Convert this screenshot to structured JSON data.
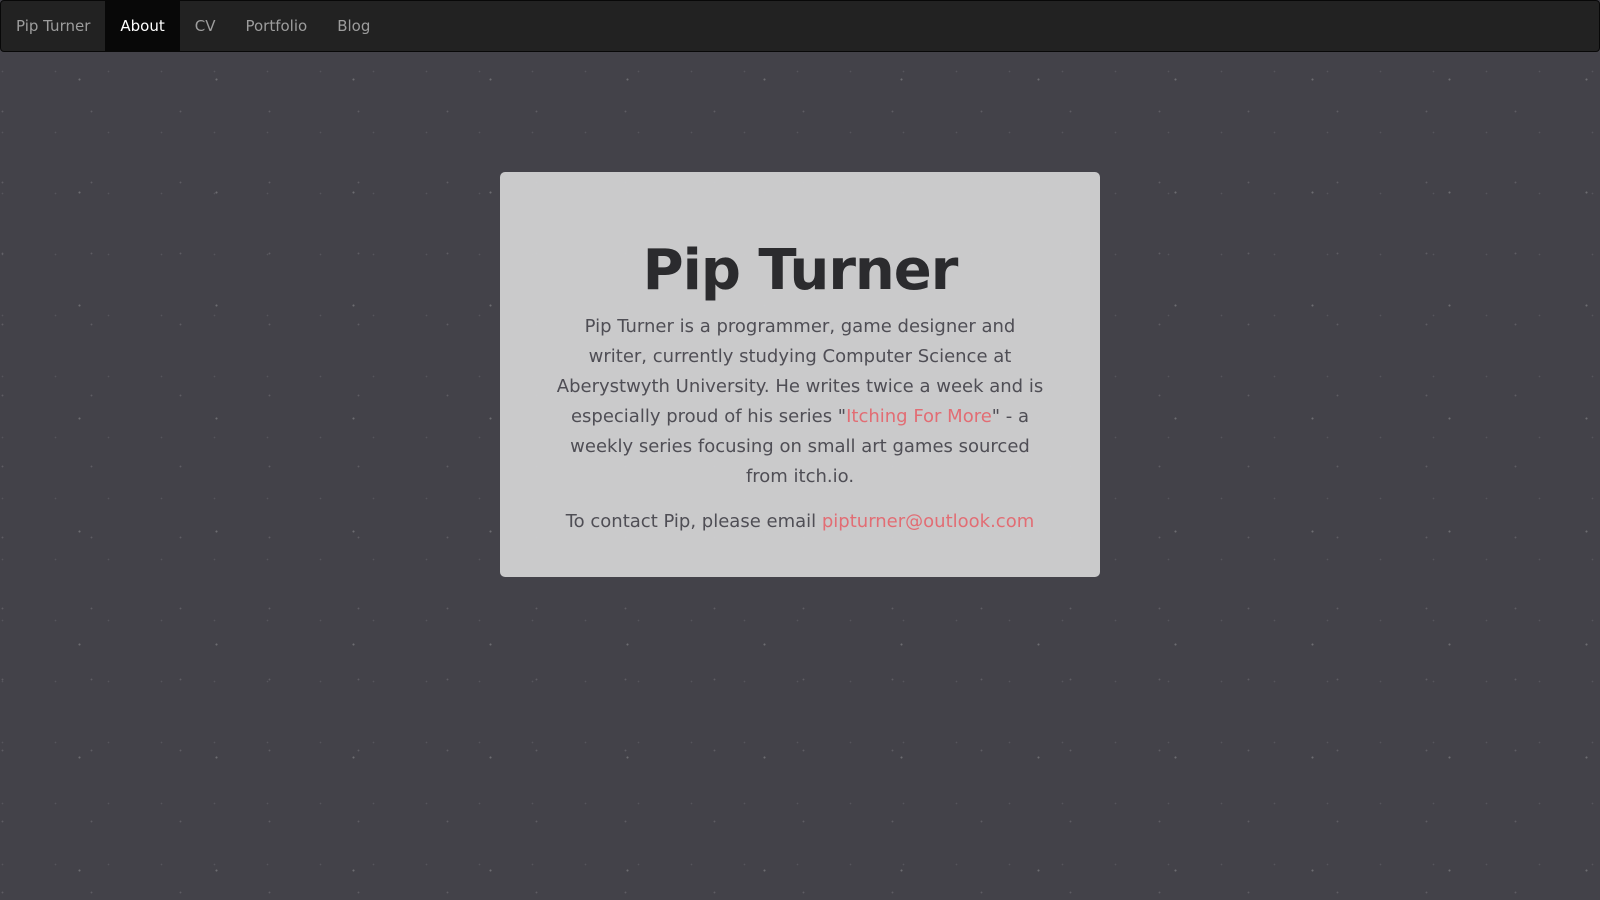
{
  "nav": {
    "brand": "Pip Turner",
    "items": [
      {
        "label": "About",
        "active": true
      },
      {
        "label": "CV",
        "active": false
      },
      {
        "label": "Portfolio",
        "active": false
      },
      {
        "label": "Blog",
        "active": false
      }
    ]
  },
  "card": {
    "title": "Pip Turner",
    "bio_before": "Pip Turner is a programmer, game designer and writer, currently studying Computer Science at Aberystwyth University. He writes twice a week and is especially proud of his series \"",
    "series_link": "Itching For More",
    "bio_after": "\" - a weekly series focusing on small art games sourced from itch.io.",
    "contact_prefix": "To contact Pip, please email ",
    "email": "pipturner@outlook.com"
  },
  "colors": {
    "background": "#434249",
    "navbar": "#222222",
    "card": "#cececf",
    "link": "#e26d74",
    "title": "#2b2b2e"
  }
}
